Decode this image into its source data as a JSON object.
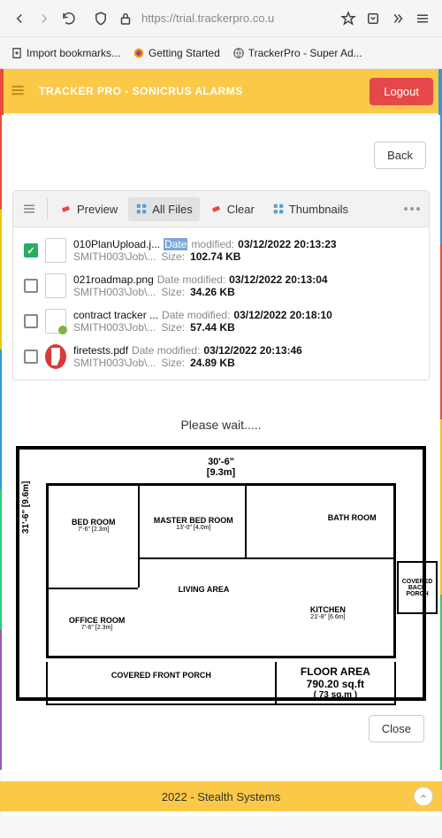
{
  "browser": {
    "url": "https://trial.trackerpro.co.u",
    "bookmarks": [
      {
        "label": "Import bookmarks...",
        "icon": "import"
      },
      {
        "label": "Getting Started",
        "icon": "firefox"
      },
      {
        "label": "TrackerPro - Super Ad...",
        "icon": "globe"
      }
    ]
  },
  "app": {
    "title": "TRACKER PRO - SONICRUS ALARMS",
    "logout": "Logout",
    "back": "Back"
  },
  "toolbar": {
    "preview": "Preview",
    "all_files": "All Files",
    "clear": "Clear",
    "thumbnails": "Thumbnails"
  },
  "files": [
    {
      "checked": true,
      "name": "010PlanUpload.j...",
      "date_label": "Date",
      "date_label_highlight": true,
      "modified_word": "modified:",
      "modified": "03/12/2022 20:13:23",
      "path": "SMITH003\\Job\\...",
      "size_label": "Size:",
      "size": "102.74 KB",
      "type": "img"
    },
    {
      "checked": false,
      "name": "021roadmap.png",
      "date_label": "Date modified:",
      "date_label_highlight": false,
      "modified_word": "",
      "modified": "03/12/2022 20:13:04",
      "path": "SMITH003\\Job\\...",
      "size_label": "Size:",
      "size": "34.26 KB",
      "type": "img"
    },
    {
      "checked": false,
      "name": "contract tracker ...",
      "date_label": "Date modified:",
      "date_label_highlight": false,
      "modified_word": "",
      "modified": "03/12/2022 20:18:10",
      "path": "SMITH003\\Job\\...",
      "size_label": "Size:",
      "size": "57.44 KB",
      "type": "xls"
    },
    {
      "checked": false,
      "name": "firetests.pdf",
      "date_label": "Date modified:",
      "date_label_highlight": false,
      "modified_word": "",
      "modified": "03/12/2022 20:13:46",
      "path": "SMITH003\\Job\\...",
      "size_label": "Size:",
      "size": "24.89 KB",
      "type": "pdf"
    }
  ],
  "preview": {
    "loading": "Please wait.....",
    "close": "Close"
  },
  "plan": {
    "top_dim": "30'-6\"",
    "top_dim_m": "[9.3m]",
    "left_dim": "31'-6\" [9.6m]",
    "bed": "BED ROOM",
    "bed_dim": "7'-6\" [2.3m]",
    "master": "MASTER BED ROOM",
    "master_dim": "13'-0\" [4.0m]",
    "bath": "BATH ROOM",
    "living": "LIVING AREA",
    "kitchen": "KITCHEN",
    "kitchen_dim": "21'-8\" [6.6m]",
    "office": "OFFICE ROOM",
    "office_dim": "7'-6\" [2.3m]",
    "back_porch": "COVERED BACK PORCH",
    "front_porch": "COVERED FRONT PORCH",
    "floor_area_label": "FLOOR AREA",
    "floor_area_sqft": "790.20 sq.ft",
    "floor_area_sqm": "( 73 sq.m )"
  },
  "footer": "2022 - Stealth Systems"
}
